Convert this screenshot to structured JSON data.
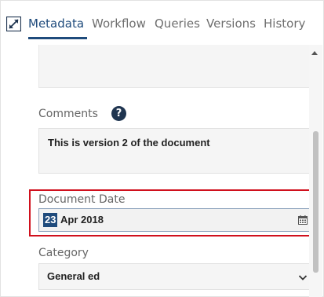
{
  "tabs": [
    {
      "label": "Metadata",
      "active": true
    },
    {
      "label": "Workflow",
      "active": false
    },
    {
      "label": "Queries",
      "active": false
    },
    {
      "label": "Versions",
      "active": false
    },
    {
      "label": "History",
      "active": false
    }
  ],
  "icons": {
    "expand": "expand-icon",
    "help": "help-icon",
    "help_glyph": "?",
    "calendar": "calendar-icon",
    "dropdown": "chevron-down-icon",
    "scroll_up": "scroll-up-arrow-icon"
  },
  "colors": {
    "accent": "#1f4b7c",
    "highlight": "#d0101d",
    "field_bg": "#f5f5f5"
  },
  "fields": {
    "comments": {
      "label": "Comments",
      "value": "This is version 2 of the document"
    },
    "document_date": {
      "label": "Document Date",
      "day_selected": "23",
      "rest": "Apr 2018"
    },
    "category": {
      "label": "Category",
      "value": "General ed"
    }
  }
}
